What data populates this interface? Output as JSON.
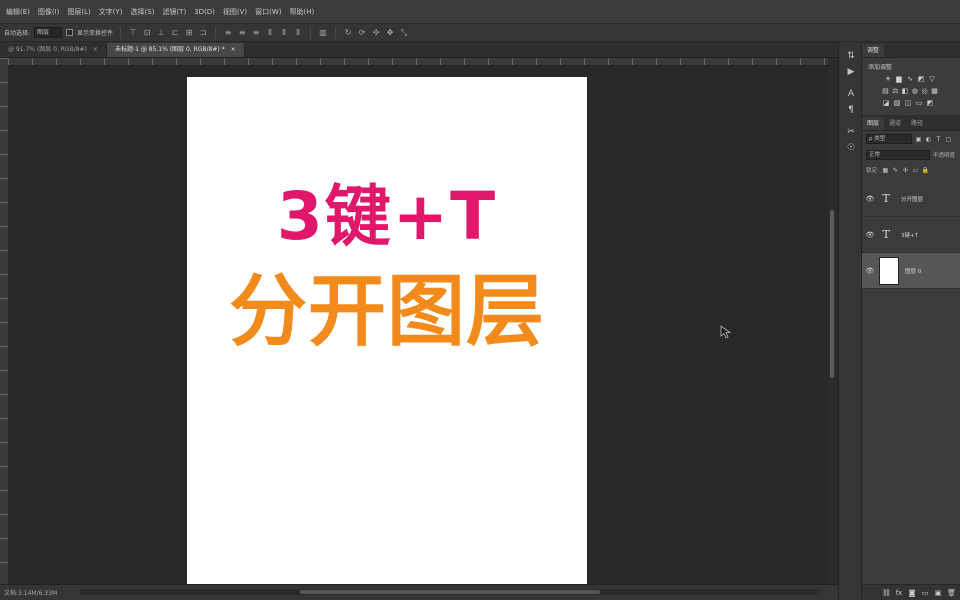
{
  "menubar": {
    "items": [
      "编辑(E)",
      "图像(I)",
      "图层(L)",
      "文字(Y)",
      "选择(S)",
      "滤镜(T)",
      "3D(D)",
      "视图(V)",
      "窗口(W)",
      "帮助(H)"
    ]
  },
  "options": {
    "auto_select_label": "自动选择:",
    "auto_select_value": "图层",
    "show_transform_label": "显示变换控件"
  },
  "tabs": [
    {
      "label": "@ 91.7% (图层 0, RGB/8#)",
      "close": "×"
    },
    {
      "label": "未标题-1 @ 85.1% (图层 0, RGB/8#) *",
      "close": "×"
    }
  ],
  "document": {
    "line1": "3键+T",
    "line2": "分开图层",
    "colors": {
      "line1": "#e0176a",
      "line2": "#f28a1c",
      "background": "#ffffff"
    }
  },
  "status": {
    "doc_size": "文档:3.14M/6.33M"
  },
  "panels": {
    "adjust_tab": "调整",
    "add_adjustment": "添加调整",
    "layer_tabs": [
      "图层",
      "通道",
      "路径"
    ],
    "kind_label": "ρ 类型",
    "blend_mode": "正常",
    "opacity_label": "不透明度",
    "lock_label": "锁定:",
    "layers": [
      {
        "type": "text",
        "name": "分开图层",
        "glyph": "T",
        "eye": "👁"
      },
      {
        "type": "text",
        "name": "3键+T",
        "glyph": "T",
        "eye": "👁"
      },
      {
        "type": "pixel",
        "name": "图层 0",
        "eye": "👁"
      }
    ]
  }
}
